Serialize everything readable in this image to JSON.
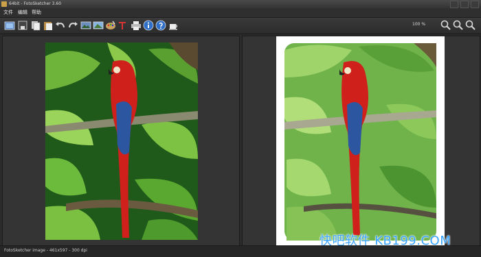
{
  "window": {
    "title": "64bit - FotoSketcher 3.60"
  },
  "menu": {
    "items": [
      "文件",
      "编辑",
      "帮助"
    ]
  },
  "toolbar": {
    "zoom": "100 %",
    "buttons": [
      "open-image-icon",
      "save-icon",
      "copy-icon",
      "paste-icon",
      "undo-icon",
      "redo-icon",
      "image-compare-icon",
      "landscape-icon",
      "palette-icon",
      "text-tool-icon",
      "print-icon",
      "info-icon",
      "help-icon",
      "coffee-icon"
    ]
  },
  "status": {
    "text": "FotoSketcher image - 461x597 - 300 dpi"
  },
  "watermark": {
    "text": "快吧软件 KB199.COM"
  },
  "colors": {
    "parrot_red": "#d0201c",
    "foliage": "#3c8a2a",
    "sky_blue": "#2c56a0"
  }
}
